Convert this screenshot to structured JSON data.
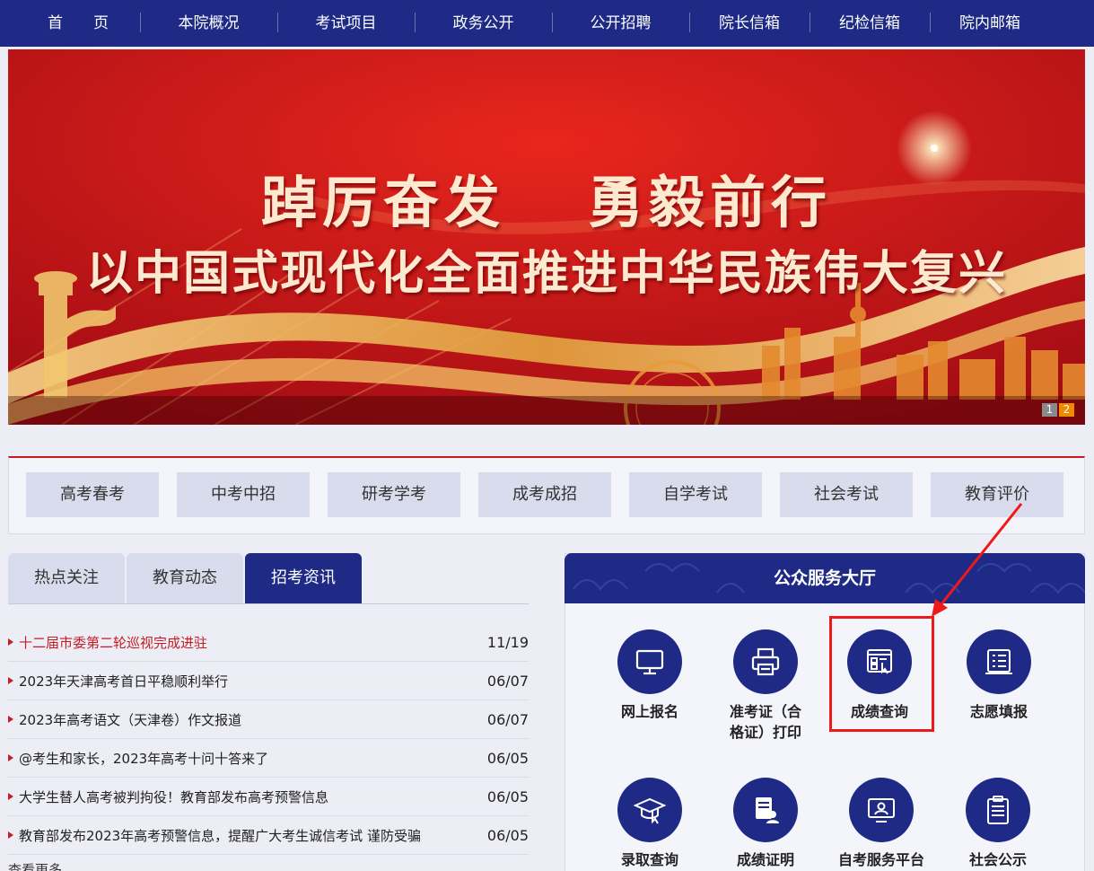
{
  "nav": {
    "items": [
      "首　　页",
      "本院概况",
      "考试项目",
      "政务公开",
      "公开招聘",
      "院长信箱",
      "纪检信箱",
      "院内邮箱"
    ]
  },
  "banner": {
    "line1_left": "踔厉奋发",
    "line1_right": "勇毅前行",
    "line2": "以中国式现代化全面推进中华民族伟大复兴",
    "slides": [
      "1",
      "2"
    ],
    "active_slide": "2"
  },
  "categories": [
    "高考春考",
    "中考中招",
    "研考学考",
    "成考成招",
    "自学考试",
    "社会考试",
    "教育评价"
  ],
  "tabs": [
    {
      "label": "热点关注",
      "active": false
    },
    {
      "label": "教育动态",
      "active": false
    },
    {
      "label": "招考资讯",
      "active": true
    }
  ],
  "news": [
    {
      "title": "十二届市委第二轮巡视完成进驻",
      "date": "11/19",
      "highlight": true
    },
    {
      "title": "2023年天津高考首日平稳顺利举行",
      "date": "06/07",
      "highlight": false
    },
    {
      "title": "2023年高考语文（天津卷）作文报道",
      "date": "06/07",
      "highlight": false
    },
    {
      "title": "@考生和家长，2023年高考十问十答来了",
      "date": "06/05",
      "highlight": false
    },
    {
      "title": "大学生替人高考被判拘役！教育部发布高考预警信息",
      "date": "06/05",
      "highlight": false
    },
    {
      "title": "教育部发布2023年高考预警信息，提醒广大考生诚信考试 谨防受骗",
      "date": "06/05",
      "highlight": false
    }
  ],
  "more_label": "查看更多",
  "service": {
    "title": "公众服务大厅",
    "items": [
      {
        "label": "网上报名",
        "icon": "monitor-icon"
      },
      {
        "label": "准考证（合格证）打印",
        "icon": "printer-icon"
      },
      {
        "label": "成绩查询",
        "icon": "score-query-icon"
      },
      {
        "label": "志愿填报",
        "icon": "form-list-icon"
      },
      {
        "label": "录取查询",
        "icon": "graduation-cap-icon"
      },
      {
        "label": "成绩证明",
        "icon": "certificate-icon"
      },
      {
        "label": "自考服务平台",
        "icon": "user-screen-icon"
      },
      {
        "label": "社会公示",
        "icon": "clipboard-icon"
      }
    ],
    "highlighted_item": "成绩查询"
  },
  "colors": {
    "nav_bg": "#1e2a86",
    "accent_red": "#c41e24",
    "annotation_red": "#f01919",
    "slide_active": "#f08a00"
  }
}
